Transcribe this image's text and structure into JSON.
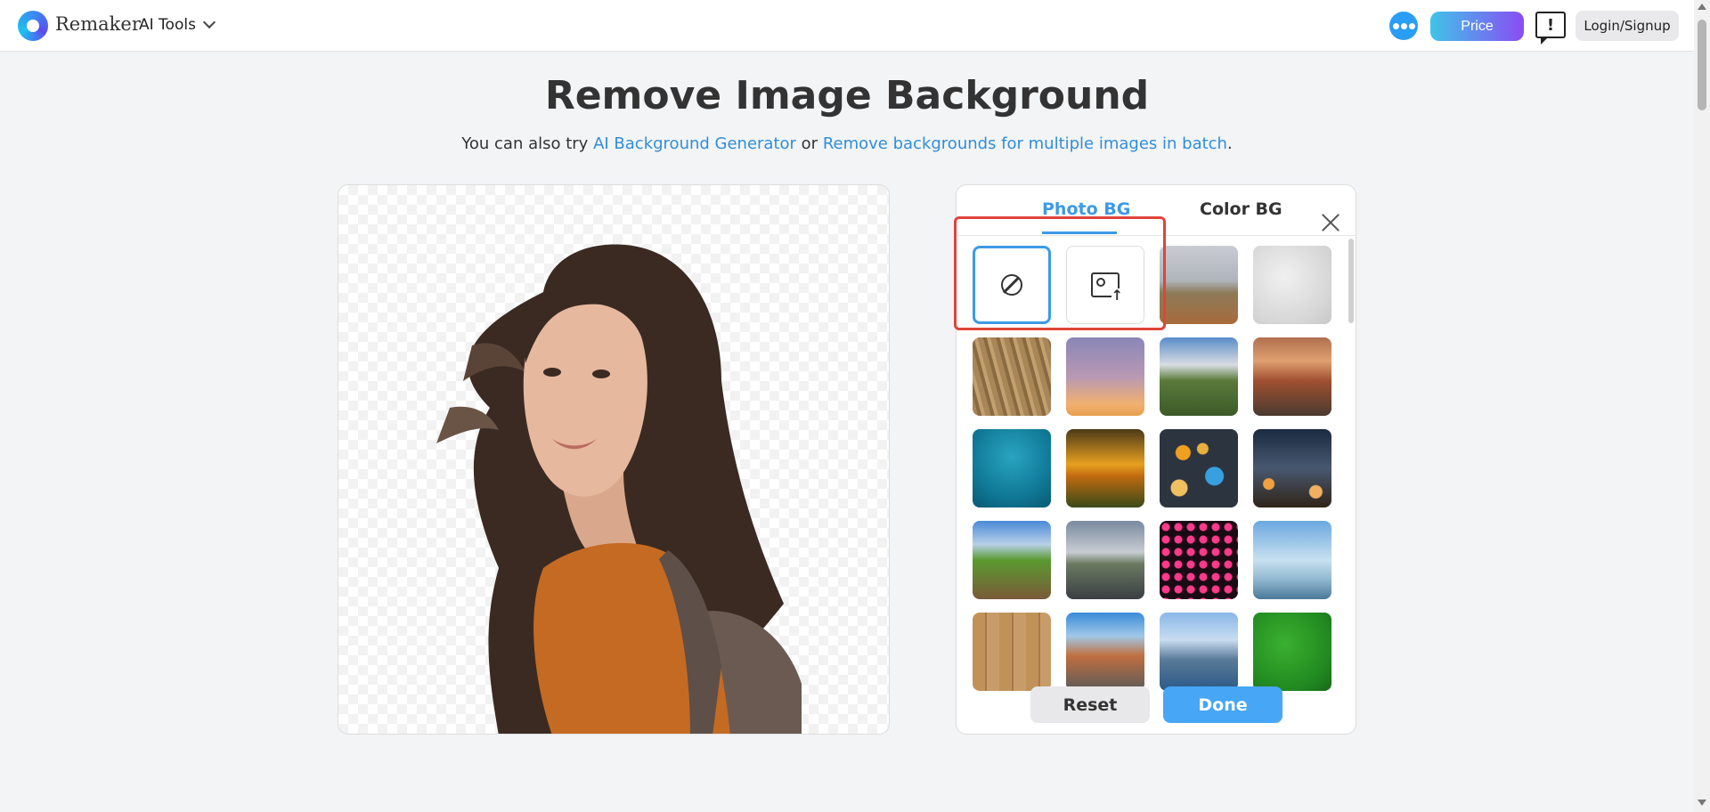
{
  "header": {
    "brand": "Remaker",
    "ai_tools_label": "AI Tools",
    "price_label": "Price",
    "login_label": "Login/Signup"
  },
  "page": {
    "title": "Remove Image Background",
    "subtitle_prefix": "You can also try",
    "subtitle_link1": "AI Background Generator",
    "subtitle_or": "or",
    "subtitle_link2": "Remove backgrounds for multiple images in batch",
    "subtitle_suffix": "."
  },
  "panel": {
    "tabs": [
      {
        "label": "Photo BG",
        "active": true
      },
      {
        "label": "Color BG",
        "active": false
      }
    ],
    "reset_label": "Reset",
    "done_label": "Done"
  },
  "colors": {
    "accent": "#3d9ae6",
    "done": "#47a6f5",
    "highlight": "#e0443a"
  }
}
